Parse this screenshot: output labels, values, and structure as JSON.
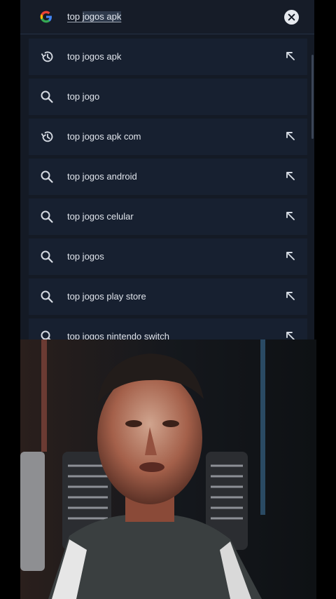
{
  "search": {
    "query_start": "top ",
    "query_selected": "jogos apk"
  },
  "colors": {
    "panel_bg": "#141a25",
    "row_bg": "#172030",
    "text": "#e1e5ec",
    "icon": "#d6dbe3"
  },
  "suggestions": [
    {
      "label": "top jogos apk",
      "icon": "history-icon",
      "has_arrow": true
    },
    {
      "label": "top jogo",
      "icon": "search-icon",
      "has_arrow": false
    },
    {
      "label": "top jogos apk com",
      "icon": "history-icon",
      "has_arrow": true
    },
    {
      "label": "top jogos android",
      "icon": "search-icon",
      "has_arrow": true
    },
    {
      "label": "top jogos celular",
      "icon": "search-icon",
      "has_arrow": true
    },
    {
      "label": "top jogos",
      "icon": "search-icon",
      "has_arrow": true
    },
    {
      "label": "top jogos play store",
      "icon": "search-icon",
      "has_arrow": true
    },
    {
      "label": "top jogos nintendo switch",
      "icon": "search-icon",
      "has_arrow": true
    }
  ]
}
